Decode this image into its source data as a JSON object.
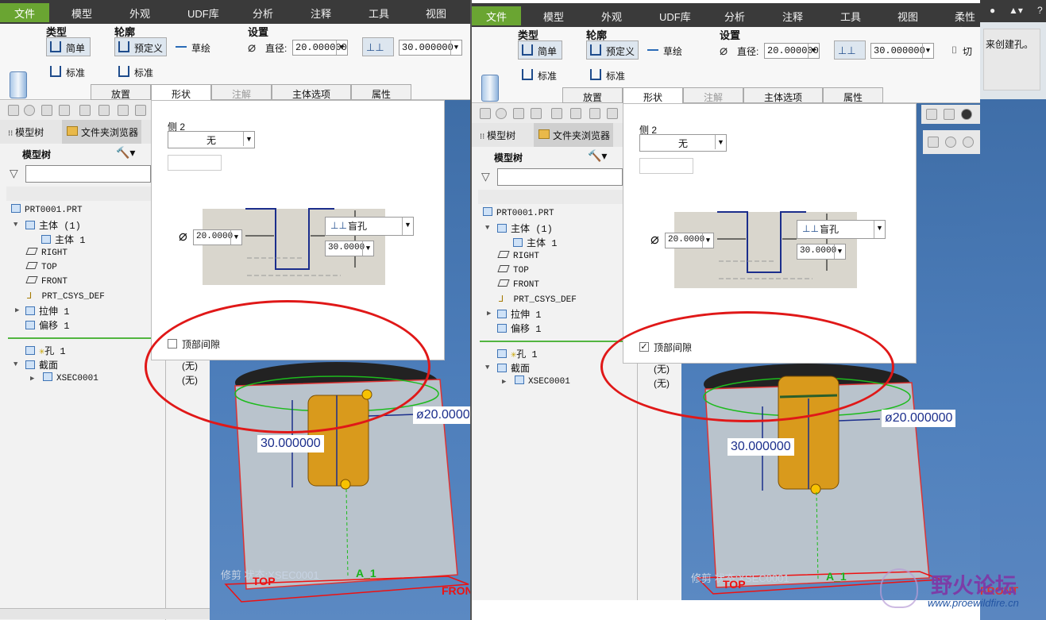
{
  "menu": [
    "文件",
    "模型",
    "外观",
    "UDF库",
    "分析",
    "注释",
    "工具",
    "视图"
  ],
  "menu_extra": "柔性建",
  "ribbon": {
    "group_type": "类型",
    "group_profile": "轮廓",
    "group_settings": "设置",
    "simple": "简单",
    "standard": "标准",
    "predefined": "预定义",
    "sketch": "草绘",
    "standard2": "标准",
    "diameter_label": "直径:",
    "diameter_value": "20.000000",
    "depth_value": "30.000000",
    "cut_label": "切"
  },
  "tabs": [
    "放置",
    "形状",
    "注解",
    "主体选项",
    "属性"
  ],
  "nav": {
    "model_tree": "模型树",
    "folder_browser": "文件夹浏览器",
    "tree_header": "模型树"
  },
  "tree": {
    "root": "PRT0001.PRT",
    "body_group": "主体 (1)",
    "body": "主体 1",
    "right": "RIGHT",
    "top": "TOP",
    "front": "FRONT",
    "csys": "PRT_CSYS_DEF",
    "extrude": "拉伸 1",
    "offset": "偏移 1",
    "hole": "孔 1",
    "section": "截面",
    "xsec": "XSEC0001"
  },
  "popup": {
    "side2": "侧 2",
    "side2_value": "无",
    "dia_value": "20.0000",
    "depth_type": "盲孔",
    "depth_value": "30.0000",
    "top_clearance": "顶部间隙"
  },
  "none_labels": [
    "(无)",
    "(无)"
  ],
  "graphics": {
    "dim_depth": "30.000000",
    "dim_dia": "ø20.000000",
    "state": "修剪 状态:XSEC0001",
    "datum_top": "TOP",
    "datum_front": "FRONT",
    "datum_axis": "A_1"
  },
  "right_hint": "来创建孔。",
  "watermark": {
    "name": "野火论坛",
    "url": "www.proewildfire.cn"
  },
  "states": {
    "left_checkbox": false,
    "right_checkbox": true
  },
  "colors": {
    "accent_green": "#6aa532",
    "highlight_red": "#e01818",
    "dim_blue": "#1b2e8c"
  }
}
